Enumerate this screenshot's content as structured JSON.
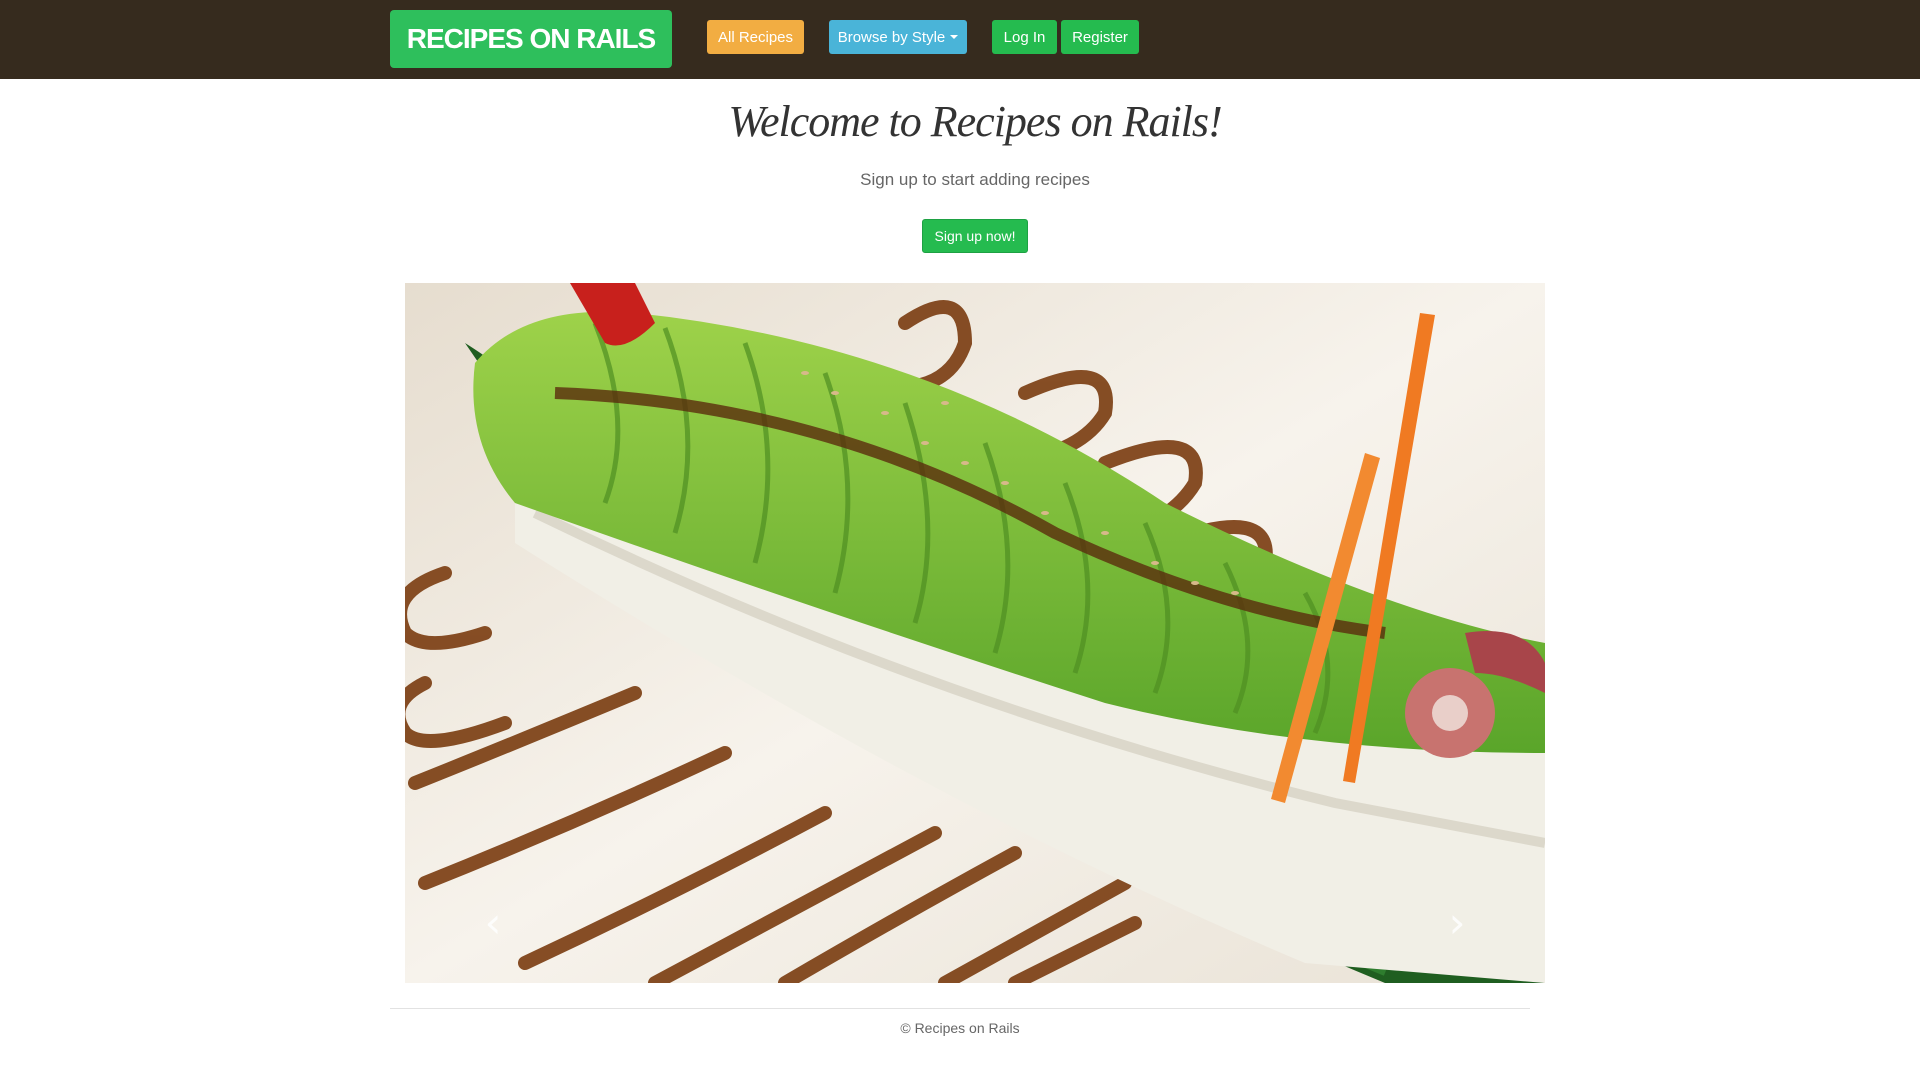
{
  "header": {
    "brand": "RECIPES ON RAILS",
    "nav": {
      "all_recipes": "All Recipes",
      "browse_by_style": "Browse by Style",
      "log_in": "Log In",
      "register": "Register"
    }
  },
  "hero": {
    "title": "Welcome to Recipes on Rails!",
    "subtitle": "Sign up to start adding recipes",
    "signup_label": "Sign up now!"
  },
  "carousel": {
    "image": "sushi-roll-photo",
    "prev_icon": "chevron-left-icon",
    "next_icon": "chevron-right-icon"
  },
  "footer": {
    "copyright": "© Recipes on Rails"
  },
  "colors": {
    "navbar": "#362b1e",
    "brand": "#2ebf5c",
    "orange_button": "#f2ad42",
    "blue_button": "#4ab4d8",
    "green_button": "#25bb4f"
  }
}
